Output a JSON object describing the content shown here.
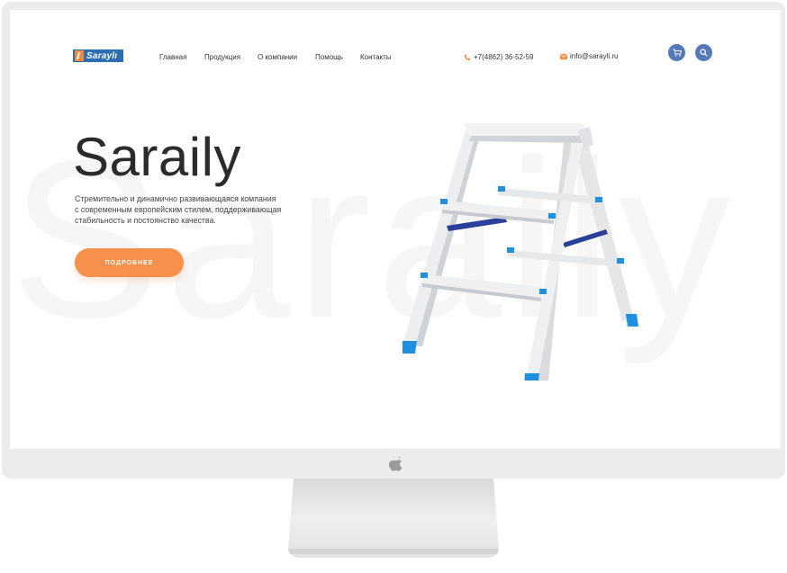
{
  "header": {
    "logo_text": "Saraylı",
    "nav": [
      "Главная",
      "Продукция",
      "О компании",
      "Помощь",
      "Контакты"
    ],
    "phone": "+7(4862) 36-52-59",
    "email": "info@sarayli.ru"
  },
  "hero": {
    "watermark": "Saraily",
    "title": "Saraily",
    "description": "Стремительно и динамично развивающаяся компания с современным европейским стилем, поддерживающая стабильность и постоянство качества.",
    "button_label": "ПОДРОБНЕЕ"
  },
  "icons": {
    "phone": "phone-icon",
    "mail": "mail-icon",
    "cart": "cart-icon",
    "search": "search-icon",
    "apple": "apple-icon"
  },
  "colors": {
    "accent_orange": "#f6904a",
    "brand_blue": "#5578b9",
    "logo_blue": "#2c6db5",
    "ladder_blue": "#1f8fe0",
    "ladder_brace": "#2a3f9a"
  }
}
